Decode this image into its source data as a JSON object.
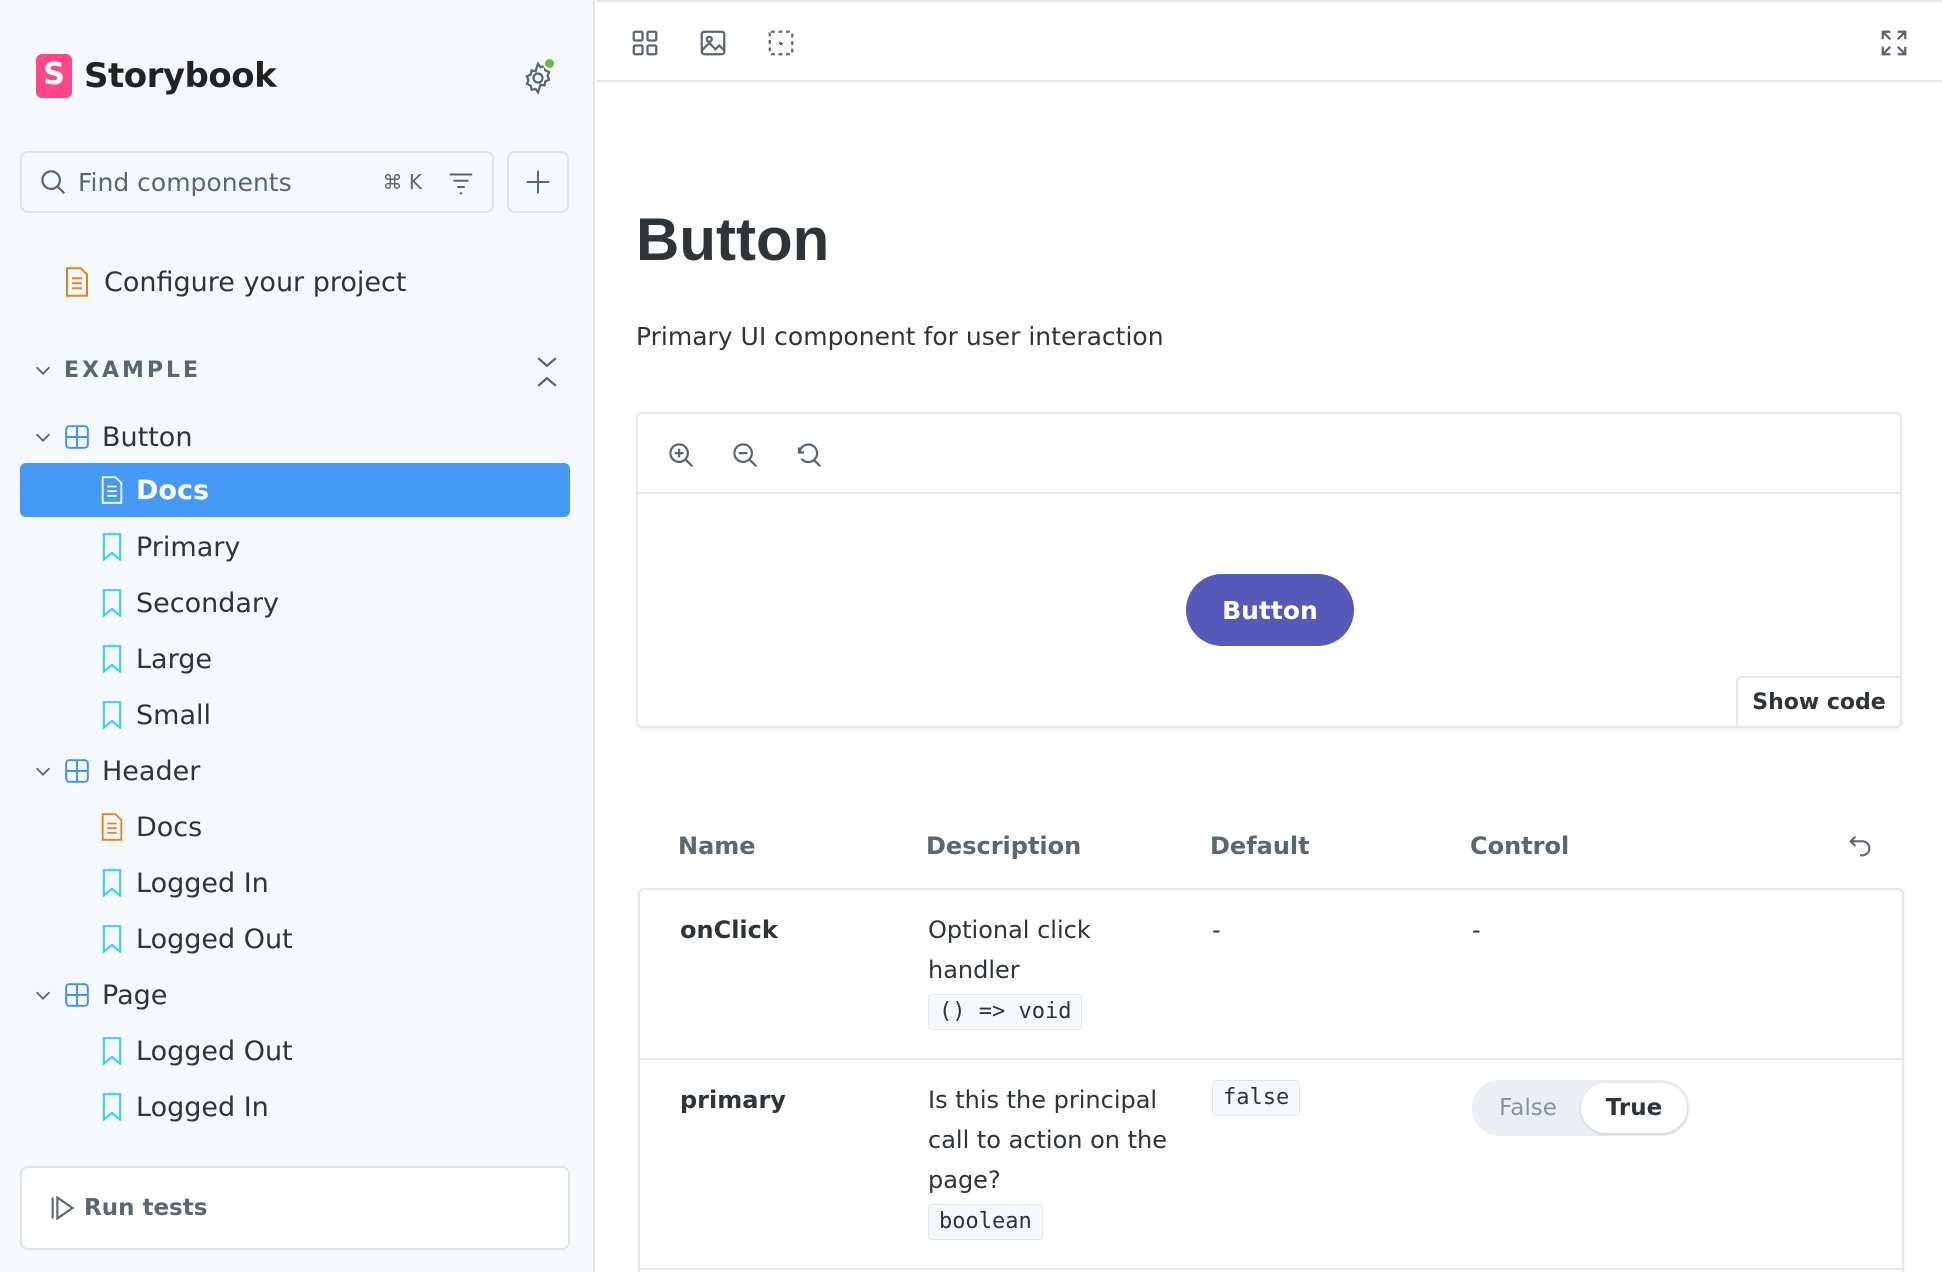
{
  "brand": {
    "logo_letter": "S",
    "name": "Storybook",
    "accent": "#ff4785"
  },
  "search": {
    "placeholder": "Find components",
    "shortcut": "⌘ K"
  },
  "sidebar": {
    "config_label": "Configure your project",
    "section_label": "EXAMPLE",
    "tree": [
      {
        "label": "Button",
        "type": "component"
      },
      {
        "label": "Docs",
        "type": "docs",
        "selected": true
      },
      {
        "label": "Primary",
        "type": "story"
      },
      {
        "label": "Secondary",
        "type": "story"
      },
      {
        "label": "Large",
        "type": "story"
      },
      {
        "label": "Small",
        "type": "story"
      },
      {
        "label": "Header",
        "type": "component"
      },
      {
        "label": "Docs",
        "type": "docs"
      },
      {
        "label": "Logged In",
        "type": "story"
      },
      {
        "label": "Logged Out",
        "type": "story"
      },
      {
        "label": "Page",
        "type": "component"
      },
      {
        "label": "Logged Out",
        "type": "story"
      },
      {
        "label": "Logged In",
        "type": "story"
      }
    ],
    "run_tests_label": "Run tests",
    "selected_color": "#4598f4"
  },
  "doc": {
    "title": "Button",
    "subtitle": "Primary UI component for user interaction",
    "preview_button_label": "Button",
    "preview_button_color": "#555ab9",
    "show_code_label": "Show code"
  },
  "args_table": {
    "headers": [
      "Name",
      "Description",
      "Default",
      "Control"
    ],
    "rows": [
      {
        "name": "onClick",
        "description": "Optional click handler",
        "type": "() => void",
        "default": "-",
        "control": "-"
      },
      {
        "name": "primary",
        "description": "Is this the principal call to action on the page?",
        "type": "boolean",
        "default": "false",
        "control_options": [
          "False",
          "True"
        ],
        "control_selected": "True"
      }
    ]
  }
}
